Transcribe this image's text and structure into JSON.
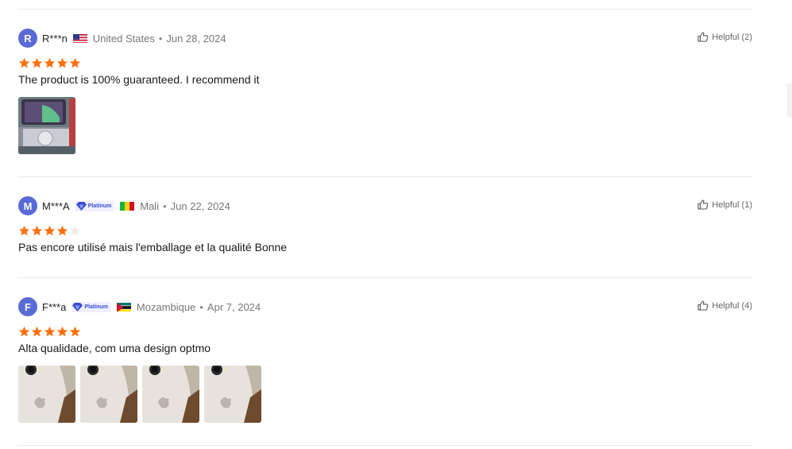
{
  "reviews": [
    {
      "initial": "R",
      "name": "R***n",
      "badge": null,
      "country": "United States",
      "flag": "us-flag",
      "date": "Jun 28, 2024",
      "rating": 5,
      "helpful": "Helpful (2)",
      "text": "The product is 100% guaranteed. I recommend it",
      "photos": 1
    },
    {
      "initial": "M",
      "name": "M***A",
      "badge": "Platinum",
      "country": "Mali",
      "flag": "mali-flag",
      "date": "Jun 22, 2024",
      "rating": 4,
      "helpful": "Helpful (1)",
      "text": "Pas encore utilisé mais l'emballage et la qualité Bonne",
      "photos": 0
    },
    {
      "initial": "F",
      "name": "F***a",
      "badge": "Platinum",
      "country": "Mozambique",
      "flag": "mozambique-flag",
      "date": "Apr 7, 2024",
      "rating": 5,
      "helpful": "Helpful (4)",
      "text": "Alta qualidade, com uma design optmo",
      "photos": 4
    }
  ],
  "colors": {
    "star_filled": "#fd6f0f",
    "star_empty": "#ececec",
    "avatar": "#5a6ad6",
    "badge_text": "#3b4bd0"
  },
  "icons": {
    "helpful": "thumbs-up-icon",
    "star": "star-icon",
    "badge": "diamond-icon"
  }
}
